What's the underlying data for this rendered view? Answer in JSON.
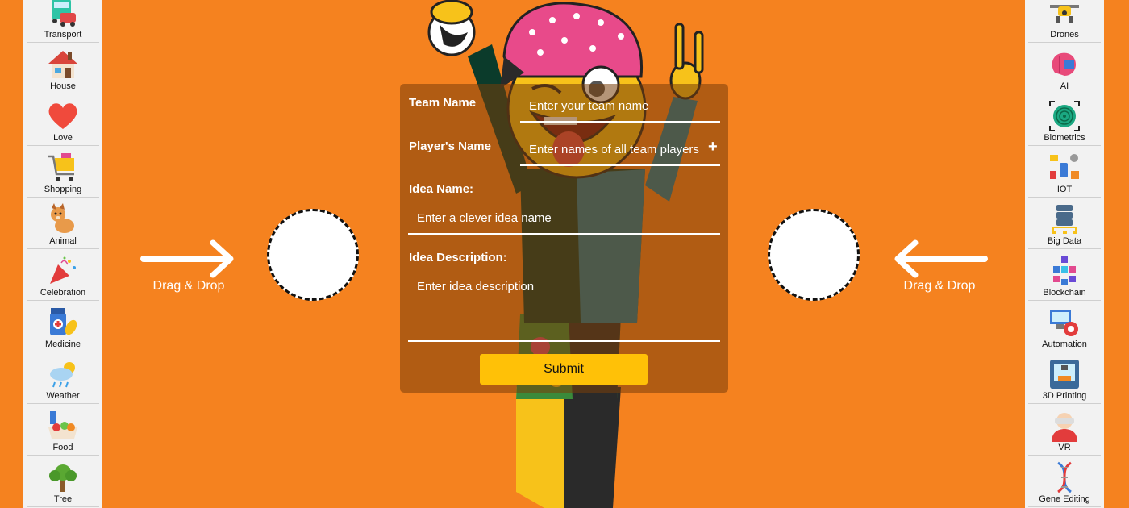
{
  "left_panel": {
    "items": [
      {
        "label": "Transport",
        "icon": "transport-icon"
      },
      {
        "label": "House",
        "icon": "house-icon"
      },
      {
        "label": "Love",
        "icon": "heart-icon"
      },
      {
        "label": "Shopping",
        "icon": "shopping-cart-icon"
      },
      {
        "label": "Animal",
        "icon": "dog-icon"
      },
      {
        "label": "Celebration",
        "icon": "party-popper-icon"
      },
      {
        "label": "Medicine",
        "icon": "medicine-icon"
      },
      {
        "label": "Weather",
        "icon": "weather-cloud-icon"
      },
      {
        "label": "Food",
        "icon": "food-icon"
      },
      {
        "label": "Tree",
        "icon": "tree-icon"
      }
    ]
  },
  "right_panel": {
    "items": [
      {
        "label": "Drones",
        "icon": "drone-icon"
      },
      {
        "label": "AI",
        "icon": "brain-chip-icon"
      },
      {
        "label": "Biometrics",
        "icon": "fingerprint-icon"
      },
      {
        "label": "IOT",
        "icon": "iot-icon"
      },
      {
        "label": "Big Data",
        "icon": "database-icon"
      },
      {
        "label": "Blockchain",
        "icon": "blockchain-icon"
      },
      {
        "label": "Automation",
        "icon": "automation-gear-icon"
      },
      {
        "label": "3D Printing",
        "icon": "3d-printer-icon"
      },
      {
        "label": "VR",
        "icon": "vr-headset-icon"
      },
      {
        "label": "Gene Editing",
        "icon": "dna-icon"
      }
    ]
  },
  "drop_zones": {
    "left_label": "Drag & Drop",
    "right_label": "Drag & Drop"
  },
  "form": {
    "team_name_label": "Team Name",
    "team_name_placeholder": "Enter your team name",
    "players_label": "Player's Name",
    "players_placeholder": "Enter names of all team players",
    "add_player_symbol": "+",
    "idea_name_label": "Idea Name:",
    "idea_name_placeholder": "Enter a clever idea name",
    "idea_desc_label": "Idea Description:",
    "idea_desc_placeholder": "Enter idea description",
    "submit_label": "Submit"
  },
  "colors": {
    "background": "#f5821f",
    "panel": "#f2f2f2",
    "submit": "#ffc107"
  }
}
